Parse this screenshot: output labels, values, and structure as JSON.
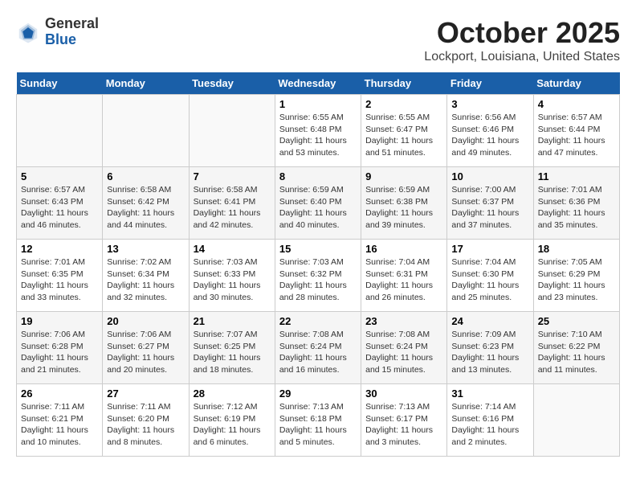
{
  "header": {
    "logo_general": "General",
    "logo_blue": "Blue",
    "month": "October 2025",
    "location": "Lockport, Louisiana, United States"
  },
  "weekdays": [
    "Sunday",
    "Monday",
    "Tuesday",
    "Wednesday",
    "Thursday",
    "Friday",
    "Saturday"
  ],
  "weeks": [
    [
      {
        "day": "",
        "info": ""
      },
      {
        "day": "",
        "info": ""
      },
      {
        "day": "",
        "info": ""
      },
      {
        "day": "1",
        "info": "Sunrise: 6:55 AM\nSunset: 6:48 PM\nDaylight: 11 hours and 53 minutes."
      },
      {
        "day": "2",
        "info": "Sunrise: 6:55 AM\nSunset: 6:47 PM\nDaylight: 11 hours and 51 minutes."
      },
      {
        "day": "3",
        "info": "Sunrise: 6:56 AM\nSunset: 6:46 PM\nDaylight: 11 hours and 49 minutes."
      },
      {
        "day": "4",
        "info": "Sunrise: 6:57 AM\nSunset: 6:44 PM\nDaylight: 11 hours and 47 minutes."
      }
    ],
    [
      {
        "day": "5",
        "info": "Sunrise: 6:57 AM\nSunset: 6:43 PM\nDaylight: 11 hours and 46 minutes."
      },
      {
        "day": "6",
        "info": "Sunrise: 6:58 AM\nSunset: 6:42 PM\nDaylight: 11 hours and 44 minutes."
      },
      {
        "day": "7",
        "info": "Sunrise: 6:58 AM\nSunset: 6:41 PM\nDaylight: 11 hours and 42 minutes."
      },
      {
        "day": "8",
        "info": "Sunrise: 6:59 AM\nSunset: 6:40 PM\nDaylight: 11 hours and 40 minutes."
      },
      {
        "day": "9",
        "info": "Sunrise: 6:59 AM\nSunset: 6:38 PM\nDaylight: 11 hours and 39 minutes."
      },
      {
        "day": "10",
        "info": "Sunrise: 7:00 AM\nSunset: 6:37 PM\nDaylight: 11 hours and 37 minutes."
      },
      {
        "day": "11",
        "info": "Sunrise: 7:01 AM\nSunset: 6:36 PM\nDaylight: 11 hours and 35 minutes."
      }
    ],
    [
      {
        "day": "12",
        "info": "Sunrise: 7:01 AM\nSunset: 6:35 PM\nDaylight: 11 hours and 33 minutes."
      },
      {
        "day": "13",
        "info": "Sunrise: 7:02 AM\nSunset: 6:34 PM\nDaylight: 11 hours and 32 minutes."
      },
      {
        "day": "14",
        "info": "Sunrise: 7:03 AM\nSunset: 6:33 PM\nDaylight: 11 hours and 30 minutes."
      },
      {
        "day": "15",
        "info": "Sunrise: 7:03 AM\nSunset: 6:32 PM\nDaylight: 11 hours and 28 minutes."
      },
      {
        "day": "16",
        "info": "Sunrise: 7:04 AM\nSunset: 6:31 PM\nDaylight: 11 hours and 26 minutes."
      },
      {
        "day": "17",
        "info": "Sunrise: 7:04 AM\nSunset: 6:30 PM\nDaylight: 11 hours and 25 minutes."
      },
      {
        "day": "18",
        "info": "Sunrise: 7:05 AM\nSunset: 6:29 PM\nDaylight: 11 hours and 23 minutes."
      }
    ],
    [
      {
        "day": "19",
        "info": "Sunrise: 7:06 AM\nSunset: 6:28 PM\nDaylight: 11 hours and 21 minutes."
      },
      {
        "day": "20",
        "info": "Sunrise: 7:06 AM\nSunset: 6:27 PM\nDaylight: 11 hours and 20 minutes."
      },
      {
        "day": "21",
        "info": "Sunrise: 7:07 AM\nSunset: 6:25 PM\nDaylight: 11 hours and 18 minutes."
      },
      {
        "day": "22",
        "info": "Sunrise: 7:08 AM\nSunset: 6:24 PM\nDaylight: 11 hours and 16 minutes."
      },
      {
        "day": "23",
        "info": "Sunrise: 7:08 AM\nSunset: 6:24 PM\nDaylight: 11 hours and 15 minutes."
      },
      {
        "day": "24",
        "info": "Sunrise: 7:09 AM\nSunset: 6:23 PM\nDaylight: 11 hours and 13 minutes."
      },
      {
        "day": "25",
        "info": "Sunrise: 7:10 AM\nSunset: 6:22 PM\nDaylight: 11 hours and 11 minutes."
      }
    ],
    [
      {
        "day": "26",
        "info": "Sunrise: 7:11 AM\nSunset: 6:21 PM\nDaylight: 11 hours and 10 minutes."
      },
      {
        "day": "27",
        "info": "Sunrise: 7:11 AM\nSunset: 6:20 PM\nDaylight: 11 hours and 8 minutes."
      },
      {
        "day": "28",
        "info": "Sunrise: 7:12 AM\nSunset: 6:19 PM\nDaylight: 11 hours and 6 minutes."
      },
      {
        "day": "29",
        "info": "Sunrise: 7:13 AM\nSunset: 6:18 PM\nDaylight: 11 hours and 5 minutes."
      },
      {
        "day": "30",
        "info": "Sunrise: 7:13 AM\nSunset: 6:17 PM\nDaylight: 11 hours and 3 minutes."
      },
      {
        "day": "31",
        "info": "Sunrise: 7:14 AM\nSunset: 6:16 PM\nDaylight: 11 hours and 2 minutes."
      },
      {
        "day": "",
        "info": ""
      }
    ]
  ]
}
